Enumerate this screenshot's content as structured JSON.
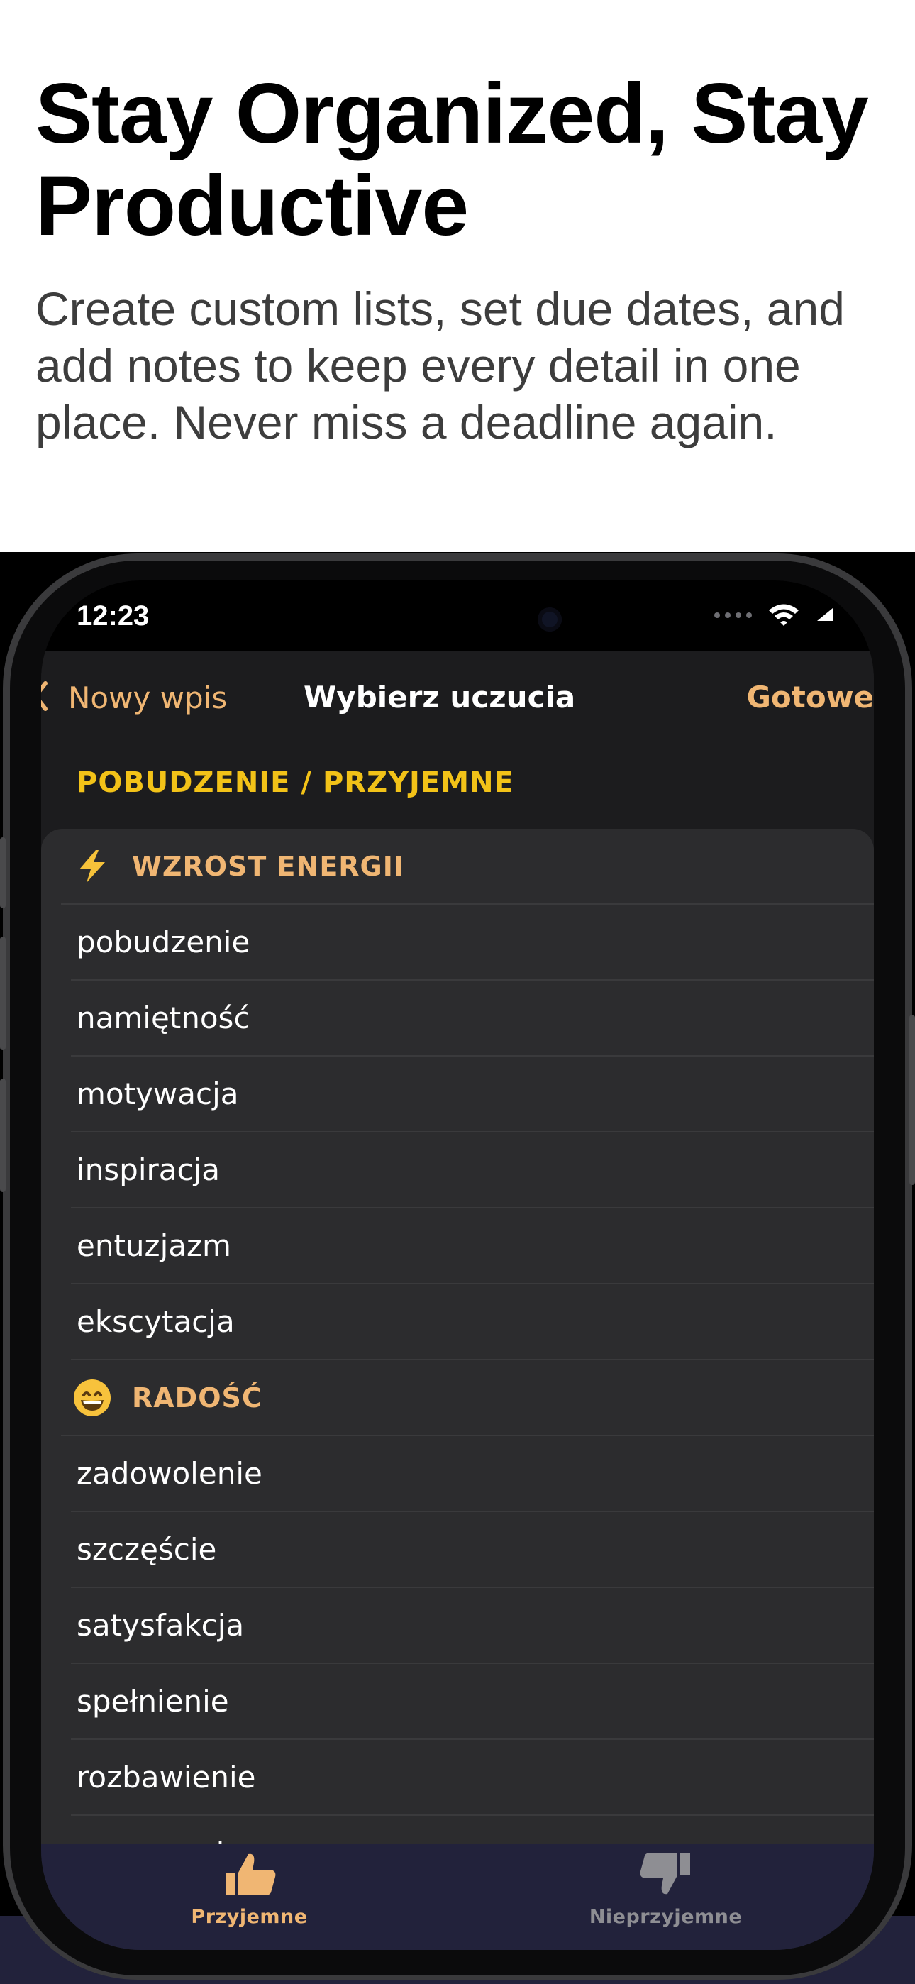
{
  "promo": {
    "headline": "Stay Organized, Stay Productive",
    "subtext": "Create custom lists, set due dates, and add notes to keep every detail in one place. Never miss a deadline again."
  },
  "status_bar": {
    "time": "12:23",
    "icons": [
      "signal-dots-icon",
      "wifi-icon",
      "battery-icon"
    ]
  },
  "nav": {
    "back_label": "Nowy wpis",
    "title": "Wybierz uczucia",
    "done_label": "Gotowe"
  },
  "section": {
    "header": "POBUDZENIE / PRZYJEMNE"
  },
  "groups": [
    {
      "icon": "lightning-bolt-icon",
      "label": "WZROST ENERGII",
      "items": [
        "pobudzenie",
        "namiętność",
        "motywacja",
        "inspiracja",
        "entuzjazm",
        "ekscytacja"
      ]
    },
    {
      "icon": "grinning-face-icon",
      "label": "RADOŚĆ",
      "items": [
        "zadowolenie",
        "szczęście",
        "satysfakcja",
        "spełnienie",
        "rozbawienie",
        "wzruszenie"
      ]
    }
  ],
  "tabs": [
    {
      "label": "Przyjemne",
      "icon": "thumbs-up-icon",
      "selected": true
    },
    {
      "label": "Nieprzyjemne",
      "icon": "thumbs-down-icon",
      "selected": false
    }
  ],
  "colors": {
    "accent": "#f0b673",
    "section_header": "#f2c218",
    "background": "#1c1c1e",
    "list_background": "#2c2c2e",
    "tabbar_background": "#22223b",
    "inactive_tab": "#8e8e93"
  }
}
